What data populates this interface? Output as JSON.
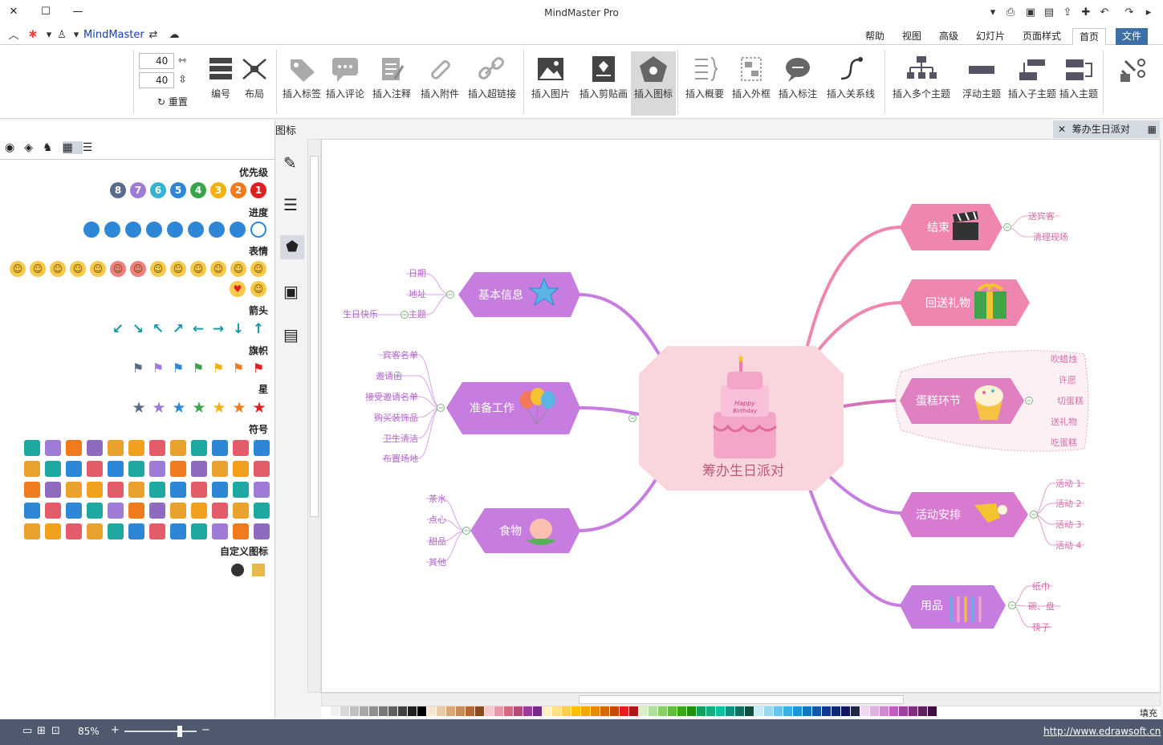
{
  "window": {
    "title": "MindMaster Pro",
    "brand": "MindMaster"
  },
  "tabs": [
    "文件",
    "首页",
    "页面样式",
    "幻灯片",
    "高级",
    "视图",
    "帮助"
  ],
  "ribbon": {
    "groups": [
      {
        "label": "插入主题"
      },
      {
        "label": "插入子主题"
      },
      {
        "label": "浮动主题"
      },
      {
        "label": "插入多个主题"
      },
      {
        "label": "插入关系线"
      },
      {
        "label": "插入标注"
      },
      {
        "label": "插入外框"
      },
      {
        "label": "插入概要"
      },
      {
        "label": "插入图标"
      },
      {
        "label": "插入剪贴画"
      },
      {
        "label": "插入图片"
      },
      {
        "label": "插入超链接"
      },
      {
        "label": "插入附件"
      },
      {
        "label": "插入注释"
      },
      {
        "label": "插入评论"
      },
      {
        "label": "插入标签"
      },
      {
        "label": "布局"
      },
      {
        "label": "编号"
      }
    ],
    "spin1": "40",
    "spin2": "40",
    "reset": "重置"
  },
  "doc_tab": "筹办生日派对",
  "panel": {
    "title": "图标",
    "sections": {
      "priority": "优先级",
      "progress": "进度",
      "emotion": "表情",
      "arrow": "箭头",
      "flag": "旗帜",
      "star": "星",
      "symbol": "符号",
      "custom": "自定义图标"
    },
    "priority_numbers": [
      "1",
      "2",
      "3",
      "4",
      "5",
      "6",
      "7",
      "8"
    ],
    "priority_colors": [
      "#e02020",
      "#f07a1e",
      "#f5b10b",
      "#3aa548",
      "#2e86d6",
      "#35b3d0",
      "#9d7bd6",
      "#5a6a8a"
    ]
  },
  "mindmap": {
    "center": "筹办生日派对",
    "branches": {
      "basic": {
        "label": "基本信息",
        "children": [
          "日期",
          "地址",
          "主题",
          "生日快乐"
        ]
      },
      "prep": {
        "label": "准备工作",
        "children": [
          "宾客名单",
          "邀请函",
          "接受邀请名单",
          "购买装饰品",
          "卫生清洁",
          "布置场地"
        ]
      },
      "food": {
        "label": "食物",
        "children": [
          "茶水",
          "点心",
          "甜品",
          "其他"
        ]
      },
      "end": {
        "label": "结束",
        "children": [
          "送宾客",
          "清理现场"
        ]
      },
      "gift": {
        "label": "回送礼物",
        "children": []
      },
      "cake": {
        "label": "蛋糕环节",
        "children": [
          "吹蜡烛",
          "许愿",
          "切蛋糕",
          "送礼物",
          "吃蛋糕"
        ]
      },
      "activity": {
        "label": "活动安排",
        "children": [
          "活动 1",
          "活动 2",
          "活动 3",
          "活动 4"
        ]
      },
      "supplies": {
        "label": "用品",
        "children": [
          "纸巾",
          "碗、盘",
          "筷子"
        ]
      }
    },
    "colors": {
      "purple": "#c77de0",
      "pink": "#ef86b0",
      "center_fill": "#f9d6db",
      "center_text": "#c0567d"
    }
  },
  "palette_label": "填充",
  "status": {
    "link": "http://www.edrawsoft.cn",
    "zoom": "85%"
  }
}
